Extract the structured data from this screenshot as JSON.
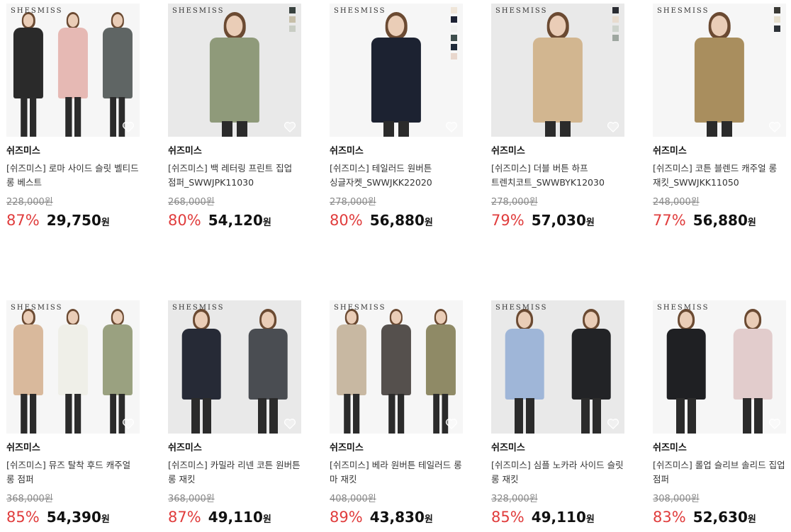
{
  "products": [
    {
      "brand": "쉬즈미스",
      "title": "[쉬즈미스] 로마 사이드 슬릿 벨티드 롱 베스트",
      "original_price": "228,000원",
      "discount": "87%",
      "price": "29,750",
      "currency": "원",
      "thumb_brand": "SHESMISS",
      "swatches": [],
      "figures": [
        "#2a2a2a",
        "#e6b9b4",
        "#5f6564"
      ]
    },
    {
      "brand": "쉬즈미스",
      "title": "[쉬즈미스] 백 레터링 프린트 집업 점퍼_SWWJPK11030",
      "original_price": "268,000원",
      "discount": "80%",
      "price": "54,120",
      "currency": "원",
      "thumb_brand": "SHESMISS",
      "swatches": [
        "#39423f",
        "#c7bfa9",
        "#c9cdc4"
      ],
      "figures": [
        "#8f9a7a"
      ]
    },
    {
      "brand": "쉬즈미스",
      "title": "[쉬즈미스] 테일러드 원버튼 싱글자켓_SWWJKK22020",
      "original_price": "278,000원",
      "discount": "80%",
      "price": "56,880",
      "currency": "원",
      "thumb_brand": "SHESMISS",
      "swatches": [
        "#efe5d8",
        "#1d2233",
        "#f0f0ef",
        "#3e4d4c",
        "#1f2a3a",
        "#e8d7cd"
      ],
      "figures": [
        "#1c2231"
      ]
    },
    {
      "brand": "쉬즈미스",
      "title": "[쉬즈미스] 더블 버튼 하프 트렌치코트_SWWBYK12030",
      "original_price": "278,000원",
      "discount": "79%",
      "price": "57,030",
      "currency": "원",
      "thumb_brand": "SHESMISS",
      "swatches": [
        "#2a2d33",
        "#e8dccf",
        "#cdd3cc",
        "#9ea7a0"
      ],
      "figures": [
        "#d2b690"
      ]
    },
    {
      "brand": "쉬즈미스",
      "title": "[쉬즈미스] 코튼 블렌드 캐주얼 롱 재킷_SWWJKK11050",
      "original_price": "248,000원",
      "discount": "77%",
      "price": "56,880",
      "currency": "원",
      "thumb_brand": "SHESMISS",
      "swatches": [
        "#3a3a36",
        "#e7e0cf",
        "#2d3238"
      ],
      "figures": [
        "#a98e5e"
      ]
    },
    {
      "brand": "쉬즈미스",
      "title": "[쉬즈미스] 뮤즈 탈착 후드 캐주얼 롱 점퍼",
      "original_price": "368,000원",
      "discount": "85%",
      "price": "54,390",
      "currency": "원",
      "thumb_brand": "SHESMISS",
      "swatches": [],
      "figures": [
        "#d9b99c",
        "#efefe8",
        "#9aa180"
      ]
    },
    {
      "brand": "쉬즈미스",
      "title": "[쉬즈미스] 카밀라 리넨 코튼 원버튼 롱 재킷",
      "original_price": "368,000원",
      "discount": "87%",
      "price": "49,110",
      "currency": "원",
      "thumb_brand": "SHESMISS",
      "swatches": [],
      "figures": [
        "#262a36",
        "#4a4d52"
      ]
    },
    {
      "brand": "쉬즈미스",
      "title": "[쉬즈미스] 베라 원버튼 테일러드 롱 마 재킷",
      "original_price": "408,000원",
      "discount": "89%",
      "price": "43,830",
      "currency": "원",
      "thumb_brand": "SHESMISS",
      "swatches": [],
      "figures": [
        "#c8b8a2",
        "#55504d",
        "#8f8a66"
      ]
    },
    {
      "brand": "쉬즈미스",
      "title": "[쉬즈미스] 심플 노카라 사이드 슬릿 롱 재킷",
      "original_price": "328,000원",
      "discount": "85%",
      "price": "49,110",
      "currency": "원",
      "thumb_brand": "SHESMISS",
      "swatches": [],
      "figures": [
        "#9fb6d8",
        "#222326"
      ]
    },
    {
      "brand": "쉬즈미스",
      "title": "[쉬즈미스] 롤업 슬리브 솔리드 집업 점퍼",
      "original_price": "308,000원",
      "discount": "83%",
      "price": "52,630",
      "currency": "원",
      "thumb_brand": "SHESMISS",
      "swatches": [],
      "figures": [
        "#1f2023",
        "#e2cccc"
      ]
    }
  ]
}
